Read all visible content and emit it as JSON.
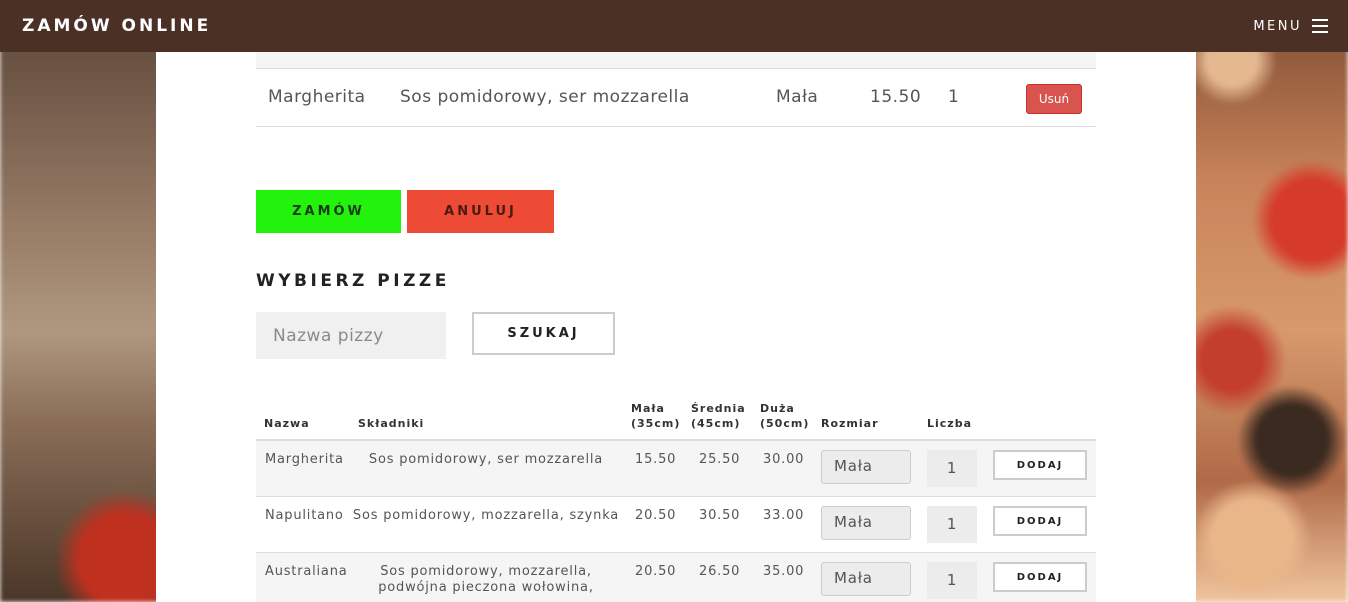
{
  "navbar": {
    "brand": "ZAMÓW ONLINE",
    "menu_label": "MENU"
  },
  "cart": {
    "items": [
      {
        "name": "Margherita",
        "ingredients": "Sos pomidorowy, ser mozzarella",
        "size": "Mała",
        "price": "15.50",
        "quantity": "1",
        "remove_label": "Usuń"
      }
    ]
  },
  "actions": {
    "order_label": "ZAMÓW",
    "cancel_label": "ANULUJ"
  },
  "picker": {
    "title": "WYBIERZ PIZZE",
    "search_placeholder": "Nazwa pizzy",
    "search_button": "SZUKAJ"
  },
  "menu_table": {
    "headers": {
      "name": "Nazwa",
      "ingredients": "Składniki",
      "small": "Mała\n(35cm)",
      "medium": "Średnia\n(45cm)",
      "large": "Duża\n(50cm)",
      "size": "Rozmiar",
      "quantity": "Liczba"
    },
    "rows": [
      {
        "name": "Margherita",
        "ingredients": "Sos pomidorowy, ser mozzarella",
        "small": "15.50",
        "medium": "25.50",
        "large": "30.00",
        "size": "Mała",
        "quantity": "1",
        "add_label": "DODAJ"
      },
      {
        "name": "Napulitano",
        "ingredients": "Sos pomidorowy, mozzarella, szynka",
        "small": "20.50",
        "medium": "30.50",
        "large": "33.00",
        "size": "Mała",
        "quantity": "1",
        "add_label": "DODAJ"
      },
      {
        "name": "Australiana",
        "ingredients": "Sos pomidorowy, mozzarella, podwójna pieczona wołowina,",
        "small": "20.50",
        "medium": "26.50",
        "large": "35.00",
        "size": "Mała",
        "quantity": "1",
        "add_label": "DODAJ"
      }
    ]
  }
}
